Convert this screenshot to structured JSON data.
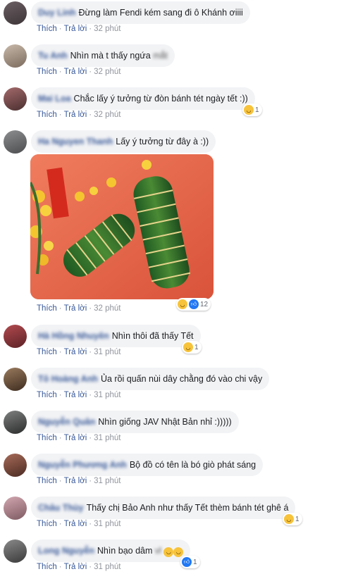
{
  "colors": {
    "link": "#385898",
    "muted": "#90949c",
    "bubble": "#f2f3f5",
    "haha": "#f7c33b",
    "like": "#2078f4"
  },
  "actions": {
    "like": "Thích",
    "reply": "Trả lời",
    "sep": "·"
  },
  "comments": [
    {
      "name": "Duy Linh",
      "text": "Đừng làm Fendi kém sang đi ô Khánh ơiiii",
      "time": "32 phút"
    },
    {
      "name": "Tu Anh",
      "text": "Nhìn mà t thấy ngứa",
      "tail": "mắt",
      "time": "32 phút"
    },
    {
      "name": "Mai Loa",
      "text": "Chắc lấy ý tưởng từ đòn bánh tét ngày tết :))",
      "time": "32 phút",
      "reaction_count": "1"
    },
    {
      "name": "Ha Nguyen Thanh",
      "text": "Lấy ý tưởng từ đây à :))",
      "time": "32 phút",
      "reaction_count": "12"
    },
    {
      "name": "Hà Hồng Nhuyên",
      "text": "Nhìn thôi đã thấy Tết",
      "time": "31 phút",
      "reaction_count": "1"
    },
    {
      "name": "Tô Hoàng Anh",
      "text": "Ủa rồi quấn nùi dây chằng đó vào chi vậy",
      "time": "31 phút"
    },
    {
      "name": "Nguyễn Quân",
      "text": "Nhìn giống JAV Nhật Bản nhỉ :)))))",
      "time": "31 phút"
    },
    {
      "name": "Nguyễn Phương Anh",
      "text": "Bộ đồ có tên là bó giò phát sáng",
      "time": "31 phút"
    },
    {
      "name": "Châu Thùy",
      "text": "Thấy chị Bảo Anh như thấy Tết thèm bánh tét ghê á",
      "time": "31 phút",
      "reaction_count": "1"
    },
    {
      "name": "Long Nguyễn",
      "text": "Nhìn bạo dâm",
      "tail": "vl",
      "time": "31 phút",
      "reaction_count": "1"
    }
  ]
}
